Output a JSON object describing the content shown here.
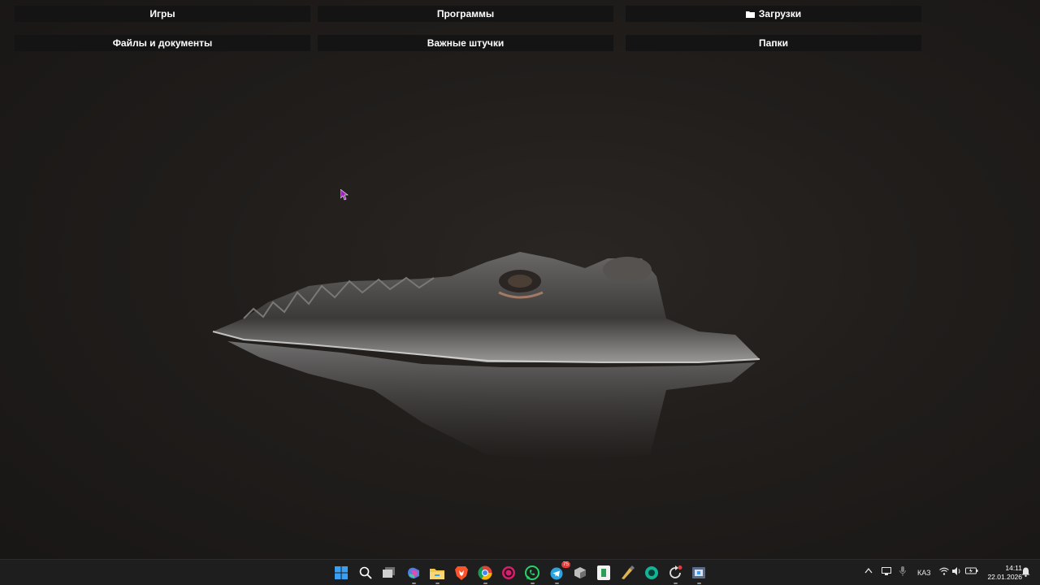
{
  "fences": {
    "games": "Игры",
    "programs": "Программы",
    "downloads": "Загрузки",
    "files_docs": "Файлы и документы",
    "important": "Важные штучки",
    "folders": "Папки"
  },
  "taskbar": {
    "icons": [
      "start-icon",
      "search-icon",
      "task-view-icon",
      "microsoft-365-icon",
      "file-explorer-icon",
      "brave-browser-icon",
      "chrome-icon",
      "app-circle-icon",
      "whatsapp-icon",
      "telegram-icon",
      "app-cube-icon",
      "app-green-icon",
      "app-brush-icon",
      "app-teal-icon",
      "app-refresh-icon",
      "app-tool-icon"
    ],
    "badges": {
      "telegram": "75"
    },
    "tray": {
      "language": "КАЗ",
      "time": "14:11",
      "date": "22.01.2026"
    }
  },
  "colors": {
    "accent_blue": "#3aa0f3",
    "taskbar_bg": "#1e1e1e",
    "fence_bg": "#141414"
  }
}
